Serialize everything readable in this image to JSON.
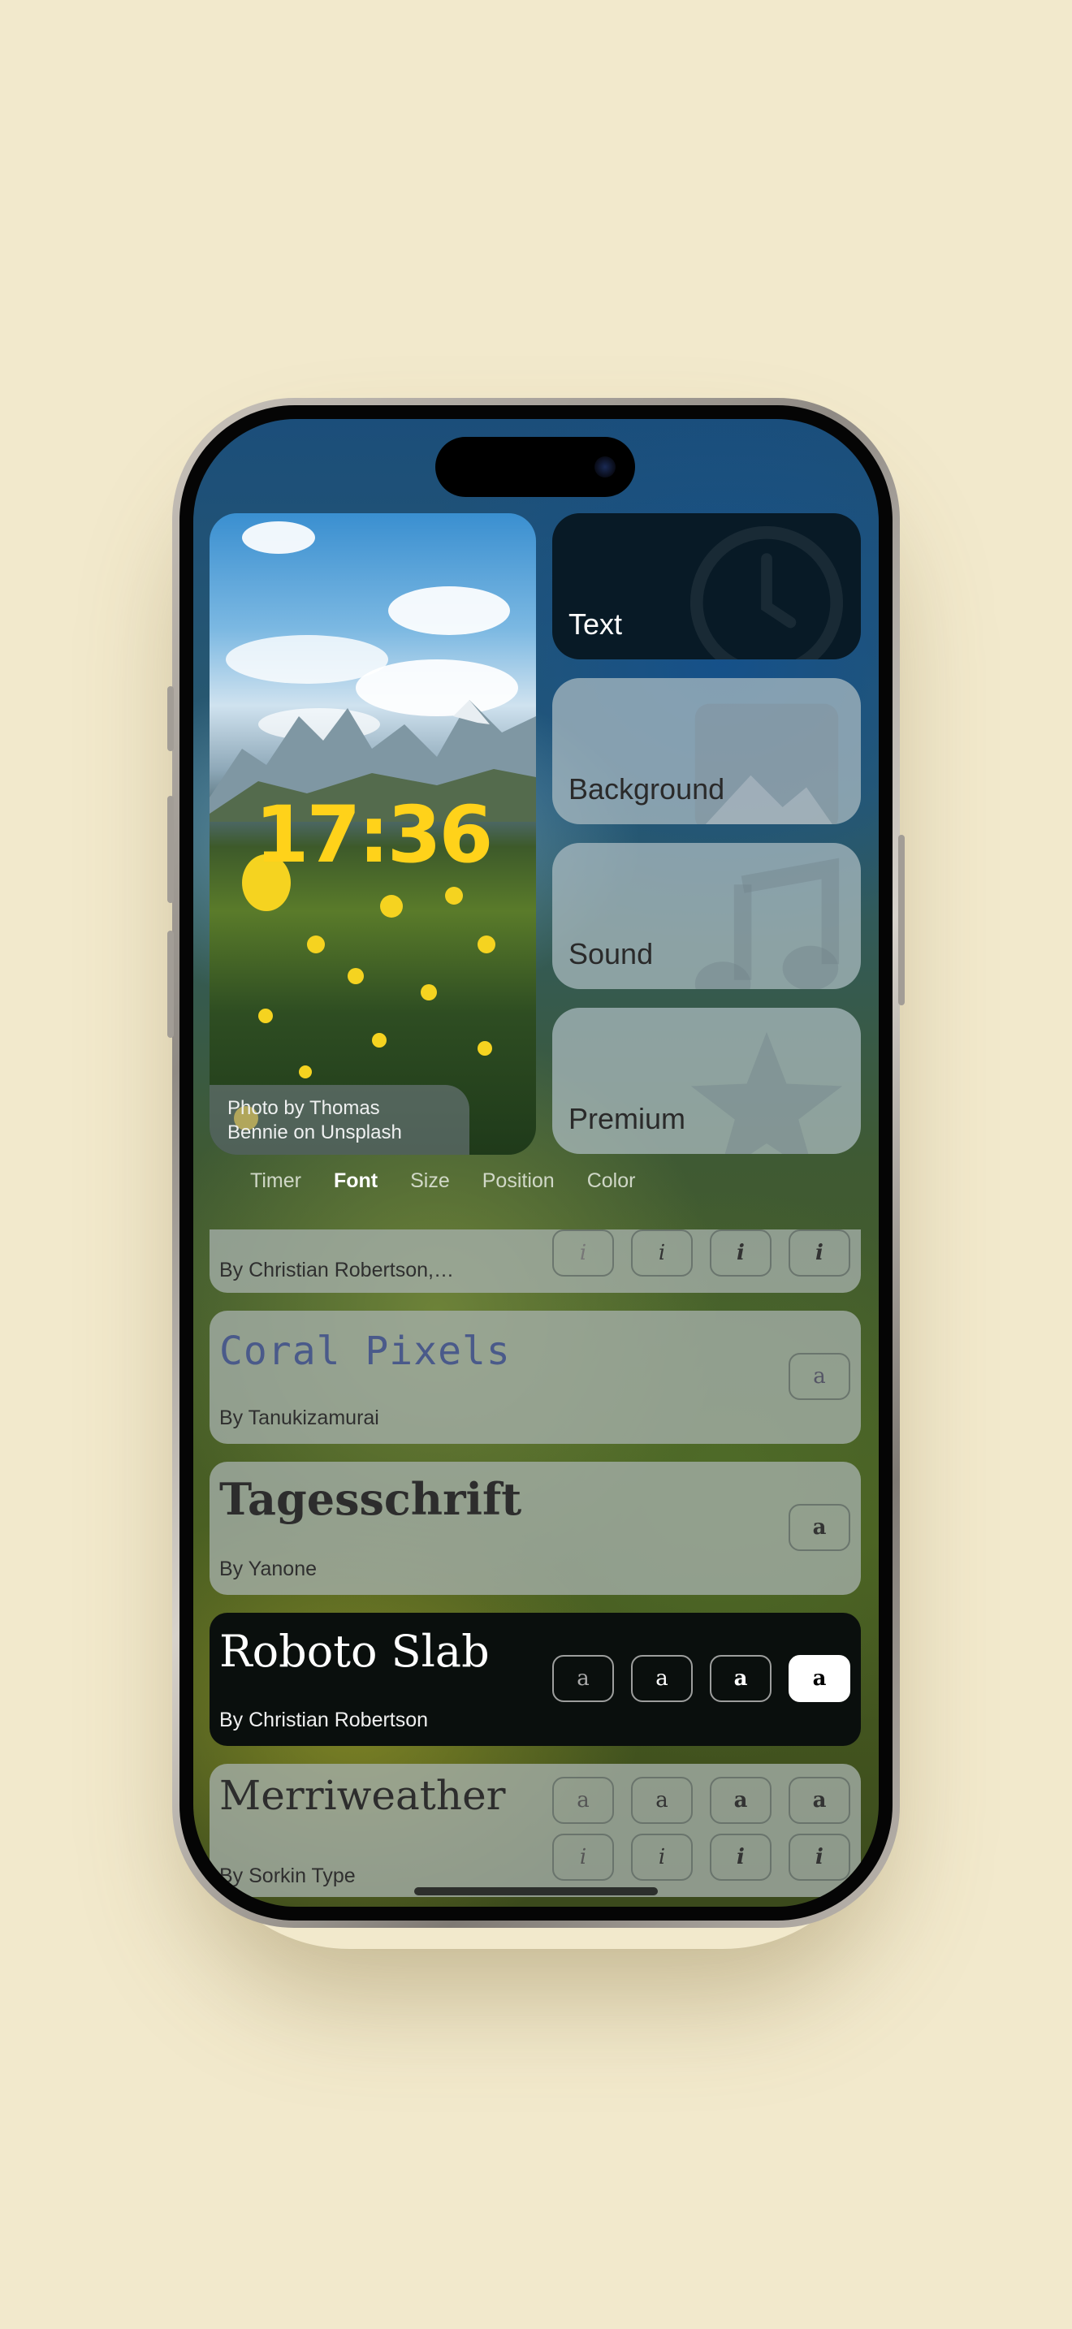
{
  "preview": {
    "time": "17:36",
    "credit_line1": "Photo by Thomas",
    "credit_line2": "Bennie on Unsplash"
  },
  "menu": {
    "text": "Text",
    "background": "Background",
    "sound": "Sound",
    "premium": "Premium"
  },
  "tabs": [
    "Timer",
    "Font",
    "Size",
    "Position",
    "Color"
  ],
  "selected_tab": "Font",
  "fonts": [
    {
      "name": "",
      "author": "By Christian Robertson,…",
      "weights": [
        "i",
        "i",
        "i",
        "i"
      ]
    },
    {
      "name": "Coral Pixels",
      "author": "By Tanukizamurai",
      "weights": [
        "a"
      ]
    },
    {
      "name": "Tagesschrift",
      "author": "By Yanone",
      "weights": [
        "a"
      ]
    },
    {
      "name": "Roboto Slab",
      "author": "By Christian Robertson",
      "weights": [
        "a",
        "a",
        "a",
        "a"
      ]
    },
    {
      "name": "Merriweather",
      "author": "By Sorkin Type",
      "weights": [
        "a",
        "a",
        "a",
        "a"
      ],
      "italics": [
        "i",
        "i",
        "i",
        "i"
      ]
    }
  ],
  "colors": {
    "background": "#f2e9cc",
    "clock": "#ffd21a",
    "active_card": "#081a26"
  },
  "icons": [
    "clock-icon",
    "image-icon",
    "music-note-icon",
    "star-icon"
  ]
}
